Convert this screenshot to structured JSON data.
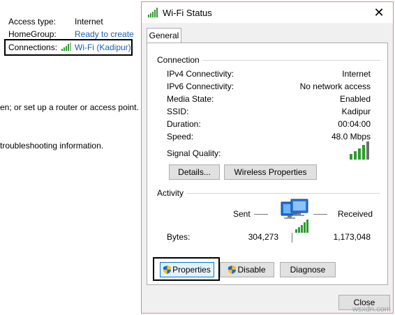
{
  "background": {
    "access_type_label": "Access type:",
    "access_type_value": "Internet",
    "homegroup_label": "HomeGroup:",
    "homegroup_value": "Ready to create",
    "connections_label": "Connections:",
    "connections_value": "Wi-Fi (Kadipur)",
    "text_line1": "en; or set up a router or access point.",
    "text_line2": "troubleshooting information."
  },
  "dialog": {
    "title": "Wi-Fi Status",
    "close_glyph": "✕",
    "tab": "General",
    "connection": {
      "heading": "Connection",
      "rows": [
        {
          "label": "IPv4 Connectivity:",
          "value": "Internet"
        },
        {
          "label": "IPv6 Connectivity:",
          "value": "No network access"
        },
        {
          "label": "Media State:",
          "value": "Enabled"
        },
        {
          "label": "SSID:",
          "value": "Kadipur"
        },
        {
          "label": "Duration:",
          "value": "00:04:00"
        },
        {
          "label": "Speed:",
          "value": "48.0 Mbps"
        }
      ],
      "signal_label": "Signal Quality:",
      "signal_bars": 5,
      "details_button": "Details...",
      "wireless_button": "Wireless Properties"
    },
    "activity": {
      "heading": "Activity",
      "sent_label": "Sent",
      "received_label": "Received",
      "bytes_label": "Bytes:",
      "bytes_sent": "304,273",
      "bytes_received": "1,173,048",
      "icon": "network-computer-icon"
    },
    "buttons": {
      "properties": "Properties",
      "disable": "Disable",
      "diagnose": "Diagnose",
      "close": "Close"
    }
  },
  "watermark": "wsxdn.com",
  "colors": {
    "link": "#1a5fb4",
    "signal": "#2e9a2e",
    "dialog_border": "#d88a8a"
  }
}
